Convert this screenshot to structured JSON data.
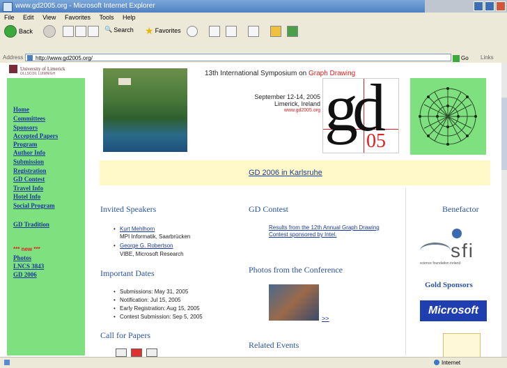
{
  "window": {
    "title": "www.gd2005.org - Microsoft Internet Explorer"
  },
  "menu": [
    "File",
    "Edit",
    "View",
    "Favorites",
    "Tools",
    "Help"
  ],
  "toolbar": {
    "back": "Back",
    "search": "Search",
    "favorites": "Favorites"
  },
  "address": {
    "label": "Address",
    "url": "http://www.gd2005.org/",
    "go": "Go",
    "links": "Links"
  },
  "logo": {
    "name": "University of Limerick",
    "sub": "OLLSCOIL LUIMNIGH"
  },
  "nav": {
    "items": [
      "Home",
      "Committees",
      "Sponsors",
      "Accepted Papers",
      "Program",
      "Author Info",
      "Submission",
      "Registration",
      "GD Contest",
      "Travel Info",
      "Hotel Info",
      "Social Program"
    ],
    "tradition": "GD Tradition",
    "new_tag": "*** new ***",
    "extra": [
      "Photos",
      "LNCS 3843",
      "GD 2006"
    ]
  },
  "header": {
    "title_prefix": "13th International Symposium on ",
    "title_highlight": "Graph Drawing",
    "dates": "September 12-14, 2005",
    "place": "Limerick, Ireland",
    "url": "www.gd2005.org",
    "logo_gd": "gd",
    "logo_05": "05"
  },
  "banner": {
    "link": "GD 2006 in Karlsruhe"
  },
  "invited": {
    "heading": "Invited Speakers",
    "speakers": [
      {
        "name": "Kurt Mehlhorn",
        "affil": "MPI Informatik, Saarbrücken"
      },
      {
        "name": "George G. Robertson",
        "affil": "VIBE, Microsoft Research"
      }
    ]
  },
  "dates_section": {
    "heading": "Important Dates",
    "items": [
      "Submissions: May 31, 2005",
      "Notification: Jul 15, 2005",
      "Early Registration: Aug 15, 2005",
      "Contest Submission: Sep 5, 2005"
    ]
  },
  "cfp": {
    "heading": "Call for Papers"
  },
  "contest": {
    "heading": "GD Contest",
    "link": "Results from the 12th Annual Graph Drawing Contest sponsored by Intel."
  },
  "photos": {
    "heading": "Photos from the Conference",
    "more": ">>"
  },
  "related": {
    "heading": "Related Events"
  },
  "sponsors": {
    "benefactor": "Benefactor",
    "sfi": "sfi",
    "sfi_sub": "science foundation ireland",
    "gold": "Gold Sponsors",
    "microsoft": "Microsoft"
  },
  "status": {
    "zone": "Internet"
  }
}
